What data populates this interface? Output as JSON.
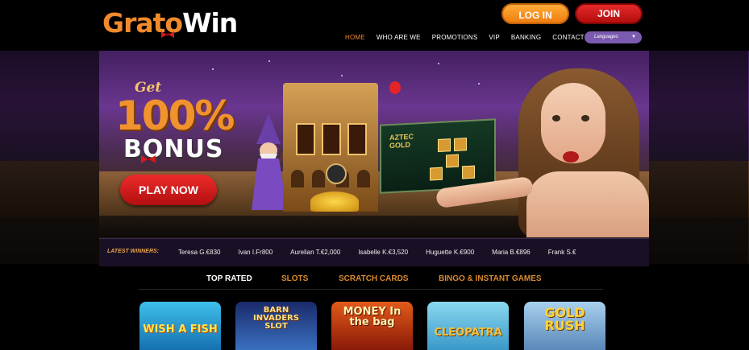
{
  "brand": {
    "logo_part1": "Grato",
    "logo_part2": "Win"
  },
  "header": {
    "login_label": "LOG IN",
    "join_label": "JOIN",
    "nav": [
      {
        "label": "HOME",
        "active": true
      },
      {
        "label": "WHO ARE WE",
        "active": false
      },
      {
        "label": "PROMOTIONS",
        "active": false
      },
      {
        "label": "VIP",
        "active": false
      },
      {
        "label": "BANKING",
        "active": false
      },
      {
        "label": "CONTACT",
        "active": false
      }
    ],
    "language_label": "Languages"
  },
  "hero": {
    "get": "Get",
    "percent": "100%",
    "bonus": "BONUS",
    "cta_label": "PLAY NOW",
    "aztec_title_1": "AZTEC",
    "aztec_title_2": "GOLD"
  },
  "winners": {
    "label": "LATEST WINNERS:",
    "items": [
      "Teresa G.€830",
      "Ivan I.Fr800",
      "Aurelian T.€2,000",
      "Isabelle K.€3,520",
      "Huguette K.€900",
      "Maria B.€896",
      "Frank S.€"
    ]
  },
  "tabs": [
    {
      "label": "TOP RATED",
      "active": true
    },
    {
      "label": "SLOTS",
      "active": false
    },
    {
      "label": "SCRATCH CARDS",
      "active": false
    },
    {
      "label": "BINGO & INSTANT GAMES",
      "active": false
    }
  ],
  "games": [
    {
      "title": "WISH A FISH",
      "color": "#27a7d8"
    },
    {
      "title": "BARN INVADERS SLOT",
      "color": "#2c5cb0"
    },
    {
      "title": "MONEY In the bag",
      "color": "#c43a16"
    },
    {
      "title": "CLEOPATRA",
      "color": "#69c7e8"
    },
    {
      "title": "GOLD RUSH",
      "color": "#7fb0d8"
    }
  ],
  "colors": {
    "orange": "#f08a2c",
    "red": "#d21b1b",
    "purple": "#7b5bb0"
  }
}
